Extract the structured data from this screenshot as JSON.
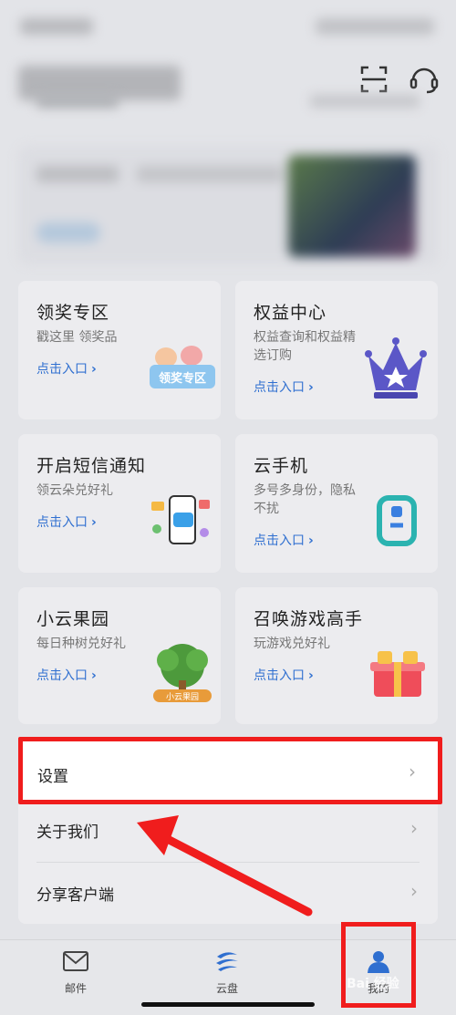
{
  "cards": [
    {
      "title": "领奖专区",
      "subtitle": "戳这里 领奖品",
      "link": "点击入口",
      "illustration_text": "领奖专区"
    },
    {
      "title": "权益中心",
      "subtitle": "权益查询和权益精选订购",
      "link": "点击入口"
    },
    {
      "title": "开启短信通知",
      "subtitle": "领云朵兑好礼",
      "link": "点击入口"
    },
    {
      "title": "云手机",
      "subtitle": "多号多身份，隐私不扰",
      "link": "点击入口"
    },
    {
      "title": "小云果园",
      "subtitle": "每日种树兑好礼",
      "link": "点击入口",
      "illustration_text": "小云果园"
    },
    {
      "title": "召唤游戏高手",
      "subtitle": "玩游戏兑好礼",
      "link": "点击入口"
    }
  ],
  "list": {
    "settings_label": "设置",
    "about_label": "关于我们",
    "share_label": "分享客户端",
    "chevron": "›"
  },
  "bottom_nav": {
    "mail_label": "邮件",
    "cloud_label": "云盘",
    "mine_label": "我的"
  },
  "watermark": "Bai 经验",
  "colors": {
    "highlight": "#f01d1d",
    "link": "#2f6fd0",
    "active_tab": "#2f6fd0"
  },
  "icons": {
    "scan": "scan-icon",
    "support": "headset-icon",
    "mail": "mail-icon",
    "cloud": "cloud-icon",
    "mine": "user-icon"
  }
}
